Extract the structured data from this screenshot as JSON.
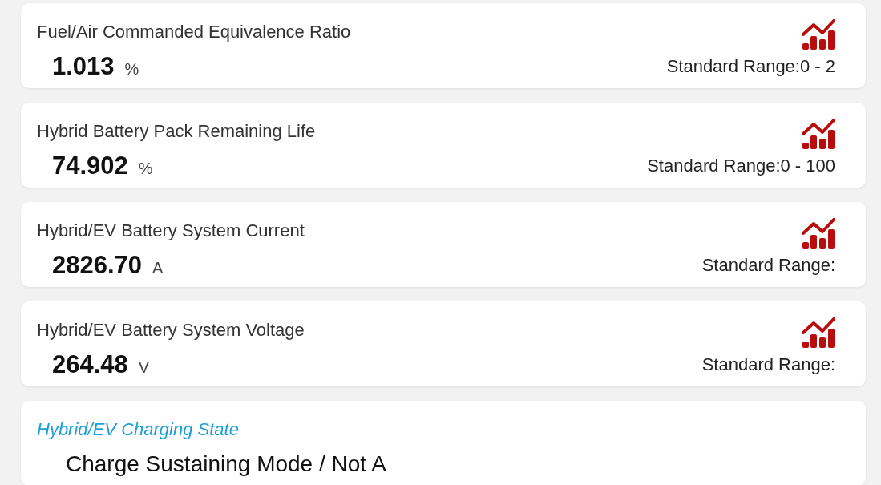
{
  "parameters": [
    {
      "kind": "numeric",
      "name": "Fuel/Air Commanded Equivalence Ratio",
      "value": "1.013",
      "unit": "%",
      "standard_range": "Standard Range:0 - 2"
    },
    {
      "kind": "numeric",
      "name": "Hybrid Battery Pack Remaining Life",
      "value": "74.902",
      "unit": "%",
      "standard_range": "Standard Range:0 - 100"
    },
    {
      "kind": "numeric",
      "name": "Hybrid/EV Battery System Current",
      "value": "2826.70",
      "unit": "A",
      "standard_range": "Standard Range:"
    },
    {
      "kind": "numeric",
      "name": "Hybrid/EV Battery System Voltage",
      "value": "264.48",
      "unit": "V",
      "standard_range": "Standard Range:"
    },
    {
      "kind": "text",
      "name": "Hybrid/EV Charging State",
      "value": "Charge Sustaining Mode / Not A"
    }
  ]
}
